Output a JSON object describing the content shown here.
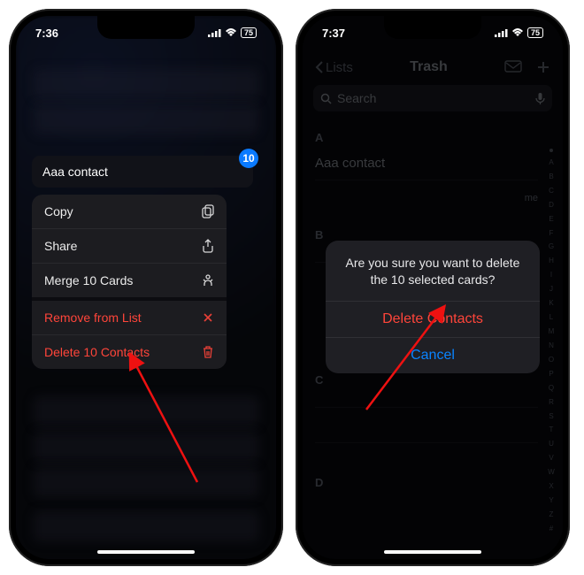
{
  "left": {
    "status": {
      "time": "7:36",
      "battery": "75"
    },
    "selected_pill": {
      "label": "Aaa contact",
      "count": "10"
    },
    "menu": {
      "copy": "Copy",
      "share": "Share",
      "merge": "Merge 10 Cards",
      "remove": "Remove from List",
      "delete": "Delete 10 Contacts"
    }
  },
  "right": {
    "status": {
      "time": "7:37",
      "battery": "75"
    },
    "nav": {
      "back": "Lists",
      "title": "Trash"
    },
    "search_placeholder": "Search",
    "sections": {
      "A": "A",
      "B": "B",
      "C": "C",
      "D": "D"
    },
    "contacts": {
      "a1": "Aaa contact",
      "me_tag": "me"
    },
    "index_letters": [
      "A",
      "B",
      "C",
      "D",
      "E",
      "F",
      "G",
      "H",
      "I",
      "J",
      "K",
      "L",
      "M",
      "N",
      "O",
      "P",
      "Q",
      "R",
      "S",
      "T",
      "U",
      "V",
      "W",
      "X",
      "Y",
      "Z",
      "#"
    ],
    "alert": {
      "title": "Are you sure you want to delete the 10 selected cards?",
      "delete": "Delete Contacts",
      "cancel": "Cancel"
    }
  }
}
